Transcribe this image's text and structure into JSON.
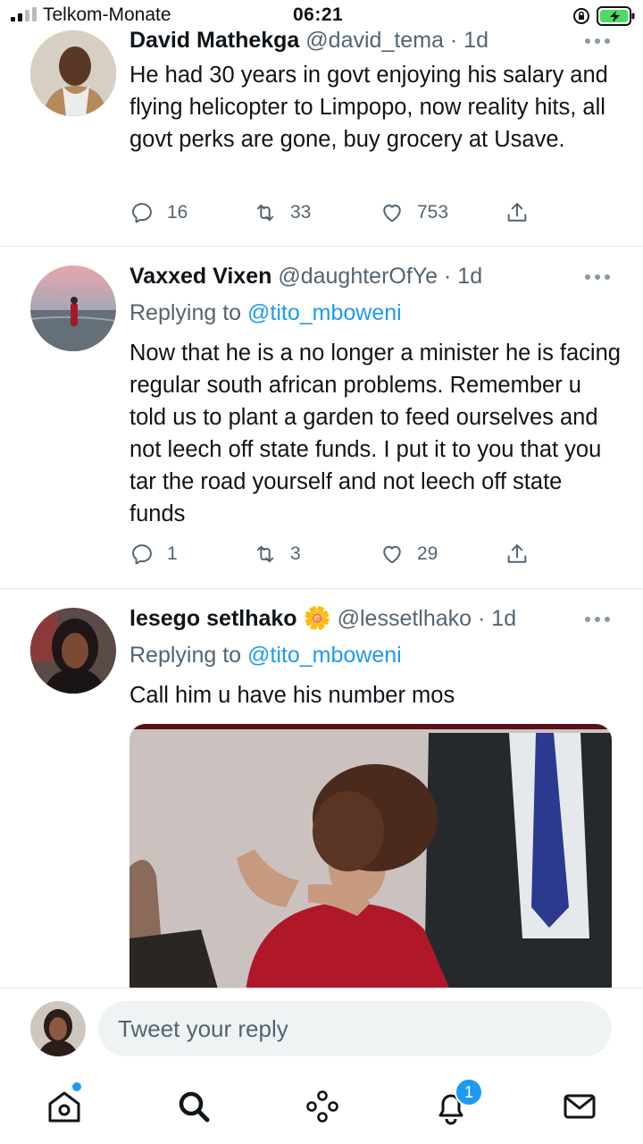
{
  "status_bar": {
    "carrier": "Telkom-Monate",
    "time": "06:21"
  },
  "tweets": [
    {
      "name": "David Mathekga",
      "handle": "@david_tema",
      "time": "· 1d",
      "replying_to": "",
      "text": "He had 30 years in govt enjoying his salary and flying helicopter to Limpopo, now reality hits, all govt perks are gone, buy grocery at Usave.",
      "replies": "16",
      "retweets": "33",
      "likes": "753"
    },
    {
      "name": "Vaxxed Vixen",
      "handle": "@daughterOfYe",
      "time": "· 1d",
      "replying_prefix": "Replying to",
      "replying_to": "@tito_mboweni",
      "text": "Now that he is a no longer a minister he is facing regular south african problems. Remember u told us to plant a garden to feed ourselves and not leech off state funds. I put it to you that you tar the road yourself and not leech off state funds",
      "replies": "1",
      "retweets": "3",
      "likes": "29"
    },
    {
      "name": "lesego setlhako",
      "emoji": "🌼",
      "handle": "@lessetlhako",
      "time": "· 1d",
      "replying_prefix": "Replying to",
      "replying_to": "@tito_mboweni",
      "text": "Call him u have his number mos"
    }
  ],
  "reply_bar": {
    "placeholder": "Tweet your reply"
  },
  "tab_bar": {
    "notifications_count": "1",
    "items": [
      "home-icon",
      "search-icon",
      "spaces-icon",
      "notifications-icon",
      "messages-icon"
    ]
  },
  "colors": {
    "accent": "#1d9bf0",
    "text": "#0f1419",
    "secondary": "#536471",
    "divider": "#e1e6ea"
  }
}
